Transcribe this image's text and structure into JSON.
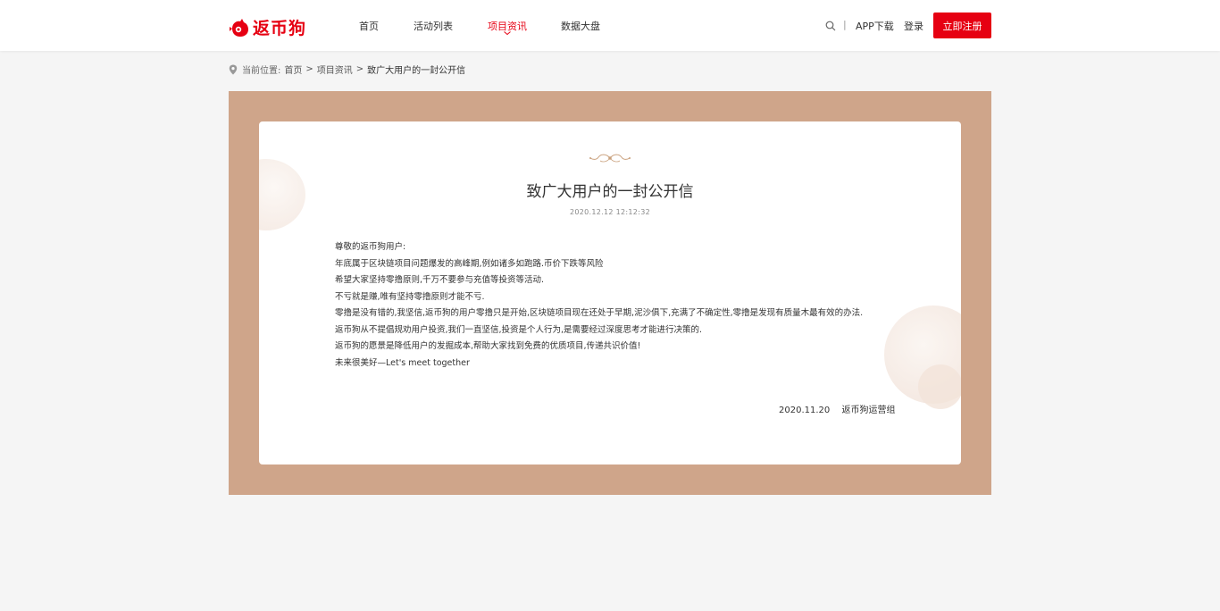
{
  "brand": {
    "name": "返币狗",
    "color": "#e60012"
  },
  "nav": {
    "items": [
      {
        "label": "首页",
        "active": false
      },
      {
        "label": "活动列表",
        "active": false
      },
      {
        "label": "项目资讯",
        "active": true
      },
      {
        "label": "数据大盘",
        "active": false
      }
    ]
  },
  "header": {
    "search_icon": "search-icon",
    "separator": "|",
    "app_download": "APP下载",
    "login": "登录",
    "register": "立即注册"
  },
  "breadcrumb": {
    "icon": "location-pin-icon",
    "prefix": "当前位置:",
    "items": [
      "首页",
      "项目资讯",
      "致广大用户的一封公开信"
    ],
    "separator": ">"
  },
  "article": {
    "title": "致广大用户的一封公开信",
    "datetime": "2020.12.12 12:12:32",
    "paragraphs": [
      "尊敬的返币狗用户:",
      "年底属于区块链项目问题爆发的高峰期,例如诸多如跑路.币价下跌等风险",
      "希望大家坚持零撸原则,千万不要参与充值等投资等活动.",
      "不亏就是赚,唯有坚持零撸原则才能不亏.",
      "零撸是没有错的,我坚信,返币狗的用户零撸只是开始,区块链项目现在还处于早期,泥沙俱下,充满了不确定性,零撸是发现有质量木最有效的办法.",
      "返币狗从不提倡规劝用户投资,我们一直坚信,投资是个人行为,是需要经过深度思考才能进行决策的.",
      "返币狗的愿景是降低用户的发掘成本,帮助大家找到免费的优质项目,传递共识价值!",
      "未来很美好—Let's meet together"
    ],
    "sign_date": "2020.11.20",
    "sign_team": "返币狗运营组"
  },
  "colors": {
    "frame": "#cfa58a",
    "accent": "#e60012"
  }
}
